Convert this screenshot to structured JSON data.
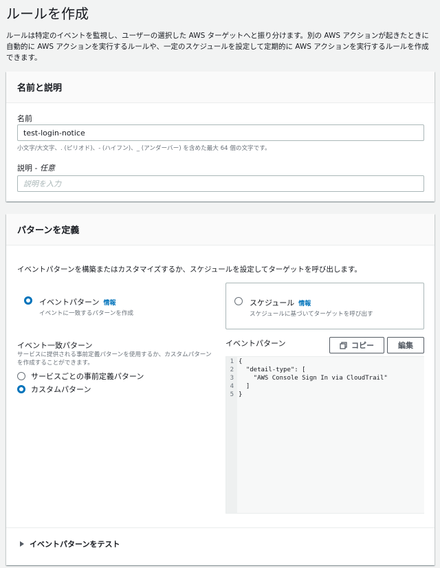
{
  "page": {
    "title": "ルールを作成",
    "description": "ルールは特定のイベントを監視し、ユーザーの選択した AWS ターゲットへと振り分けます。別の AWS アクションが起きたときに自動的に AWS アクションを実行するルールや、一定のスケジュールを設定して定期的に AWS アクションを実行するルールを作成できます。"
  },
  "name_section": {
    "header": "名前と説明",
    "name_label": "名前",
    "name_value": "test-login-notice",
    "name_hint": "小文字/大文字、. (ピリオド)、- (ハイフン)、_ (アンダーバー) を含めた最大 64 個の文字です。",
    "desc_label": "説明 - ",
    "desc_optional": "任意",
    "desc_placeholder": "説明を入力"
  },
  "pattern_section": {
    "header": "パターンを定義",
    "description": "イベントパターンを構築またはカスタマイズするか、スケジュールを設定してターゲットを呼び出します。",
    "event_tile": {
      "title": "イベントパターン",
      "info": "情報",
      "subtitle": "イベントに一致するパターンを作成",
      "selected": true
    },
    "schedule_tile": {
      "title": "スケジュール",
      "info": "情報",
      "subtitle": "スケジュールに基づいてターゲットを呼び出す",
      "selected": false
    },
    "match_title": "イベント一致パターン",
    "match_desc": "サービスに提供される事前定義パターンを使用するか、カスタムパターンを作成することができます。",
    "options": [
      {
        "label": "サービスごとの事前定義パターン",
        "selected": false
      },
      {
        "label": "カスタムパターン",
        "selected": true
      }
    ],
    "editor_label": "イベントパターン",
    "copy_button": "コピー",
    "edit_button": "編集",
    "code_lines": [
      {
        "n": "1",
        "text": "{"
      },
      {
        "n": "2",
        "text": "  \"detail-type\": ["
      },
      {
        "n": "3",
        "text": "    \"AWS Console Sign In via CloudTrail\""
      },
      {
        "n": "4",
        "text": "  ]"
      },
      {
        "n": "5",
        "text": "}"
      }
    ],
    "test_expander": "イベントパターンをテスト"
  },
  "colors": {
    "accent": "#0073bb",
    "background": "#f2f3f3",
    "text": "#16191f",
    "muted": "#687078"
  }
}
